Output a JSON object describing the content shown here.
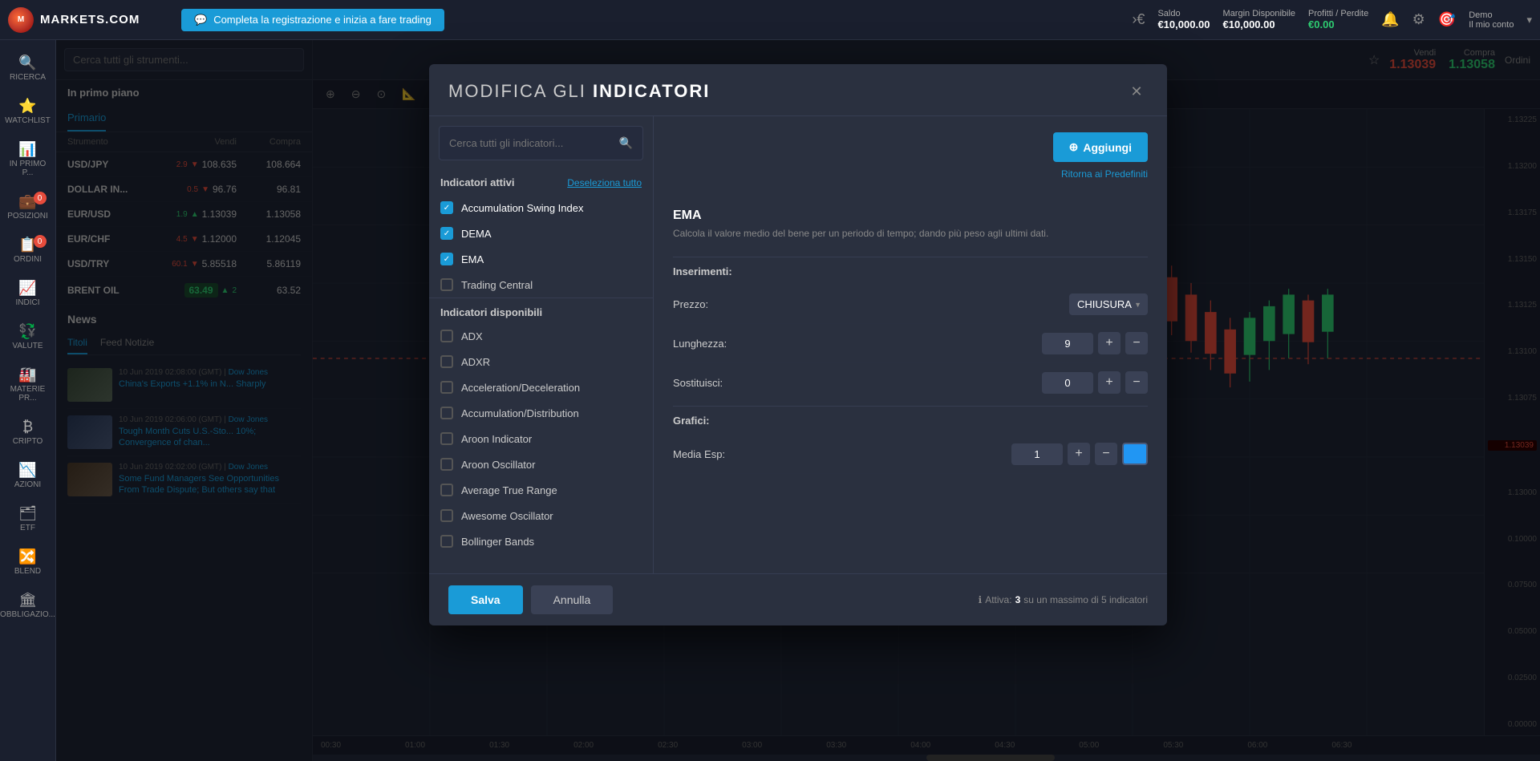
{
  "topnav": {
    "logo_text": "MARKETS.COM",
    "promo_text": "Completa la registrazione e inizia a fare trading",
    "saldo_label": "Saldo",
    "saldo_val": "€10,000.00",
    "margin_label": "Margin Disponibile",
    "margin_val": "€10,000.00",
    "profitti_label": "Profitti / Perdite",
    "profitti_val": "€0.00",
    "demo_label": "Demo",
    "account_label": "Il mio conto"
  },
  "sidebar": {
    "items": [
      {
        "id": "ricerca",
        "label": "RICERCA",
        "icon": "🔍",
        "badge": null
      },
      {
        "id": "watchlist",
        "label": "WATCHLIST",
        "icon": "⭐",
        "badge": null
      },
      {
        "id": "in-primo-piano",
        "label": "IN PRIMO P...",
        "icon": "📊",
        "badge": null
      },
      {
        "id": "posizioni",
        "label": "POSIZIONI",
        "icon": "💼",
        "badge": "0"
      },
      {
        "id": "ordini",
        "label": "ORDINI",
        "icon": "📋",
        "badge": "0"
      },
      {
        "id": "indici",
        "label": "INDICI",
        "icon": "📈",
        "badge": null
      },
      {
        "id": "valute",
        "label": "VALUTE",
        "icon": "💱",
        "badge": null
      },
      {
        "id": "materie-prime",
        "label": "MATERIE PR...",
        "icon": "🏭",
        "badge": null
      },
      {
        "id": "cripto",
        "label": "CRIPTO",
        "icon": "₿",
        "badge": null
      },
      {
        "id": "azioni",
        "label": "AZIONI",
        "icon": "📉",
        "badge": null
      },
      {
        "id": "etf",
        "label": "ETF",
        "icon": "🗂",
        "badge": null
      },
      {
        "id": "blend",
        "label": "BLEND",
        "icon": "🔀",
        "badge": null
      },
      {
        "id": "obbligazioni",
        "label": "OBBLIGAZIO...",
        "icon": "🏛",
        "badge": null
      }
    ]
  },
  "watchlist": {
    "search_placeholder": "Cerca tutti gli strumenti...",
    "in_primo_piano": "In primo piano",
    "tab_primario": "Primario",
    "col_strumento": "Strumento",
    "col_vendi": "Vendi",
    "col_compra": "Compra",
    "instruments": [
      {
        "name": "USD/JPY",
        "sell": "108.635",
        "change": "-2.9",
        "buy": "108.664",
        "dir": "down"
      },
      {
        "name": "DOLLAR IN...",
        "sell": "96.76",
        "change": "-0.5",
        "buy": "96.81",
        "dir": "down"
      },
      {
        "name": "EUR/USD",
        "sell": "1.13039",
        "change": "+1.9",
        "buy": "1.13058",
        "dir": "up"
      },
      {
        "name": "EUR/CHF",
        "sell": "1.12000",
        "change": "-4.5",
        "buy": "1.12045",
        "dir": "down"
      },
      {
        "name": "USD/TRY",
        "sell": "5.85518",
        "change": "-60.1",
        "buy": "5.86119",
        "dir": "down"
      },
      {
        "name": "BRENT OIL",
        "sell_highlight": "63.49",
        "change": "+2",
        "buy": "63.52",
        "dir": "up"
      }
    ]
  },
  "news": {
    "title": "News",
    "tabs": [
      {
        "label": "Titoli",
        "active": true
      },
      {
        "label": "Feed Notizie",
        "active": false
      }
    ],
    "items": [
      {
        "date": "10 Jun 2019 02:08:00 (GMT)",
        "source": "Dow Jones",
        "headline": "China's Exports +1.1% in N... Sharply"
      },
      {
        "date": "10 Jun 2019 02:06:00 (GMT)",
        "source": "Dow Jones",
        "headline": "Tough Month Cuts U.S.-Sto... 10%; Convergence of chan..."
      },
      {
        "date": "10 Jun 2019 02:02:00 (GMT)",
        "source": "Dow Jones",
        "headline": "Some Fund Managers See Opportunities From Trade Dispute; But others say that"
      }
    ]
  },
  "chart_header": {
    "sell_label": "Vendi",
    "sell_price": "1.13039",
    "buy_label": "Compra",
    "buy_price": "1.13058",
    "orders_label": "Ordini"
  },
  "modal": {
    "title_prefix": "MODIFICA GLI",
    "title_bold": "INDICATORI",
    "search_placeholder": "Cerca tutti gli indicatori...",
    "active_section_label": "Indicatori attivi",
    "deselect_all_label": "Deseleziona tutto",
    "available_section_label": "Indicatori disponibili",
    "active_indicators": [
      {
        "label": "Accumulation Swing Index",
        "checked": true
      },
      {
        "label": "DEMA",
        "checked": true
      },
      {
        "label": "EMA",
        "checked": true
      }
    ],
    "available_indicators": [
      {
        "label": "ADX",
        "checked": false
      },
      {
        "label": "ADXR",
        "checked": false
      },
      {
        "label": "Acceleration/Deceleration",
        "checked": false
      },
      {
        "label": "Accumulation/Distribution",
        "checked": false
      },
      {
        "label": "Aroon Indicator",
        "checked": false
      },
      {
        "label": "Aroon Oscillator",
        "checked": false
      },
      {
        "label": "Average True Range",
        "checked": false
      },
      {
        "label": "Awesome Oscillator",
        "checked": false
      },
      {
        "label": "Bollinger Bands",
        "checked": false
      }
    ],
    "trading_central_label": "Trading Central",
    "ema_title": "EMA",
    "ema_description": "Calcola il valore medio del bene per un periodo di tempo; dando più peso agli ultimi dati.",
    "inserimenti_label": "Inserimenti:",
    "prezzo_label": "Prezzo:",
    "prezzo_value": "CHIUSURA",
    "lunghezza_label": "Lunghezza:",
    "lunghezza_value": "9",
    "sostituisci_label": "Sostituisci:",
    "sostituisci_value": "0",
    "grafici_label": "Grafici:",
    "media_esp_label": "Media Esp:",
    "media_esp_value": "1",
    "add_button_label": "Aggiungi",
    "reset_label": "Ritorna ai Predefiniti",
    "save_label": "Salva",
    "cancel_label": "Annulla",
    "footer_active_text": "Attiva:",
    "footer_active_count": "3",
    "footer_max_text": "su un massimo di 5 indicatori"
  },
  "price_ticks": [
    "1.13225",
    "1.13200",
    "1.13175",
    "1.13150",
    "1.13125",
    "1.13100",
    "1.13075",
    "1.13039",
    "1.13000",
    "0.10000",
    "0.07500",
    "0.05000",
    "0.02500",
    "0.00000"
  ],
  "time_ticks": [
    "00:30",
    "01:00",
    "01:30",
    "02:00",
    "02:30",
    "03:00",
    "03:30",
    "04:00",
    "04:30",
    "05:00",
    "05:30",
    "06:00",
    "06:30"
  ]
}
